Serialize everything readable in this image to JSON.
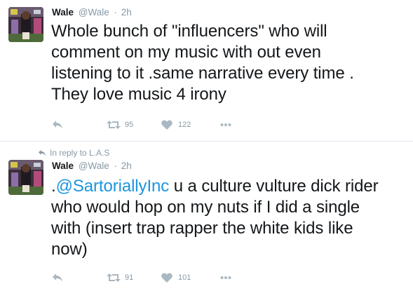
{
  "tweets": [
    {
      "name": "Wale",
      "handle": "@Wale",
      "separator": "·",
      "time": "2h",
      "text_parts": [
        "Whole bunch of \"influencers\" who will",
        "comment on my music with out even",
        "listening to it .same narrative every time .",
        "They love music 4 irony"
      ],
      "retweets": "95",
      "likes": "122",
      "icons": [
        "reply-icon",
        "retweet-icon",
        "like-heart-icon",
        "more-dots-icon"
      ]
    },
    {
      "reply_context": "In reply to L.A.S",
      "name": "Wale",
      "handle": "@Wale",
      "separator": "·",
      "time": "2h",
      "line1_prefix": ".",
      "mention": "@SartoriallyInc",
      "line1_rest": " u a culture vulture dick rider",
      "lines": [
        "who would hop on my nuts if I did a single",
        "with (insert trap rapper the white kids like",
        "now)"
      ],
      "retweets": "91",
      "likes": "101",
      "icons": [
        "reply-icon",
        "retweet-icon",
        "like-heart-icon",
        "more-dots-icon"
      ]
    }
  ],
  "colors": {
    "text": "#14171a",
    "muted": "#8899a6",
    "icon": "#aab8c2",
    "link": "#1b95e0",
    "divider": "#e1e8ed"
  }
}
